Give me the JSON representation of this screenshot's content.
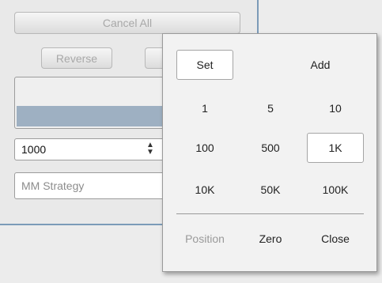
{
  "panel": {
    "cancel_all_label": "Cancel All",
    "reverse_label": "Reverse",
    "quantity_value": "1000",
    "strategy_placeholder": "MM Strategy"
  },
  "colors": {
    "progress_fill": "#9eb0c2",
    "panel_border": "#7b9bb8"
  },
  "popup": {
    "mode_set": "Set",
    "mode_add": "Add",
    "rows": [
      [
        "1",
        "5",
        "10"
      ],
      [
        "100",
        "500",
        "1K"
      ],
      [
        "10K",
        "50K",
        "100K"
      ]
    ],
    "selected": "1K",
    "footer": [
      "Position",
      "Zero",
      "Close"
    ]
  }
}
